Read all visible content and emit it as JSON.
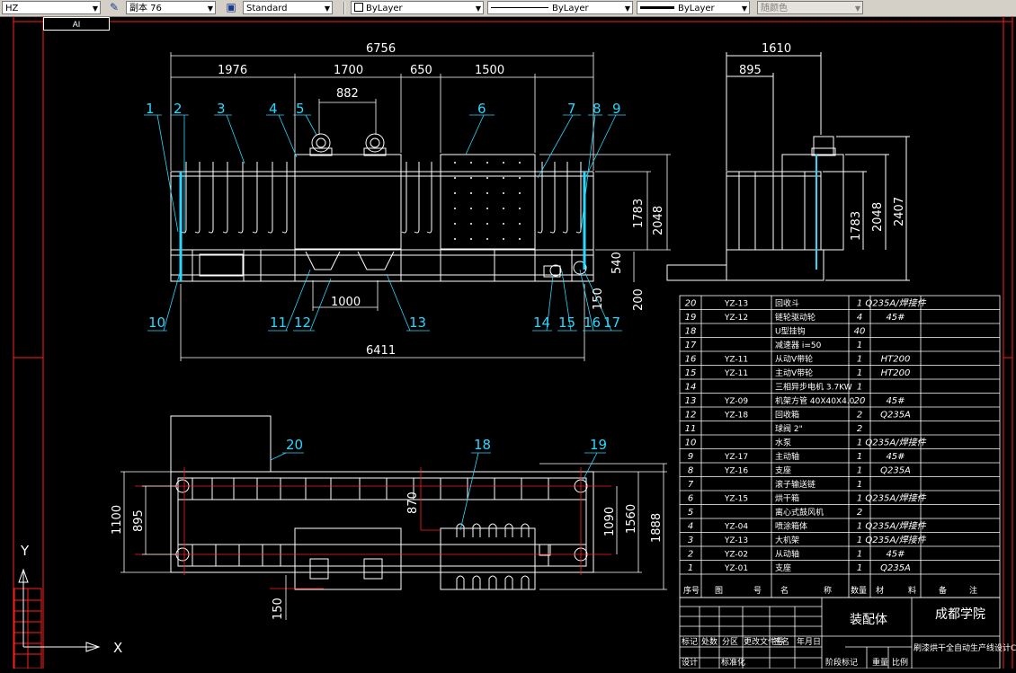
{
  "toolbar": {
    "layer": "HZ",
    "dimstyle": "副本 76",
    "textstyle": "Standard",
    "color": "ByLayer",
    "linetype": "ByLayer",
    "lineweight": "ByLayer",
    "plotstyle": "随颜色"
  },
  "tab": "AI",
  "ucs": {
    "x": "X",
    "y": "Y"
  },
  "colors": {
    "accent": "#29d8ff",
    "border": "#ff0000",
    "lines": "#ffffff"
  },
  "front_view": {
    "dims_top": [
      "6756",
      "1976",
      "1700",
      "650",
      "1500",
      "882"
    ],
    "dims_right": [
      "1783",
      "2048"
    ],
    "dims_small": [
      "540",
      "150",
      "200"
    ],
    "dims_bottom": [
      "1000",
      "6411"
    ],
    "callouts_top": [
      "1",
      "2",
      "3",
      "4",
      "5",
      "6",
      "7",
      "8",
      "9"
    ],
    "callouts_bottom": [
      "10",
      "11",
      "12",
      "13",
      "14",
      "15",
      "16",
      "17"
    ]
  },
  "side_view": {
    "dims": [
      "1610",
      "895",
      "1783",
      "2048",
      "2407"
    ]
  },
  "plan_view": {
    "dims_left": [
      "1100",
      "895"
    ],
    "dims_mid": [
      "870"
    ],
    "dims_right": [
      "1090",
      "1560",
      "1888"
    ],
    "dims_bottom": [
      "150"
    ],
    "callouts": [
      "20",
      "18",
      "19"
    ]
  },
  "parts_table": {
    "rows": [
      {
        "no": "20",
        "code": "YZ-13",
        "name": "回收斗",
        "qty": "1",
        "mat": "Q235A/焊接件"
      },
      {
        "no": "19",
        "code": "YZ-12",
        "name": "链轮驱动轮",
        "qty": "4",
        "mat": "45#"
      },
      {
        "no": "18",
        "code": "",
        "name": "U型挂钩",
        "qty": "40",
        "mat": ""
      },
      {
        "no": "17",
        "code": "",
        "name": "减速器 i=50",
        "qty": "1",
        "mat": ""
      },
      {
        "no": "16",
        "code": "YZ-11",
        "name": "从动V带轮",
        "qty": "1",
        "mat": "HT200"
      },
      {
        "no": "15",
        "code": "YZ-11",
        "name": "主动V带轮",
        "qty": "1",
        "mat": "HT200"
      },
      {
        "no": "14",
        "code": "",
        "name": "三相异步电机 3.7KW",
        "qty": "1",
        "mat": ""
      },
      {
        "no": "13",
        "code": "YZ-09",
        "name": "机架方管 40X40X4.0",
        "qty": "20",
        "mat": "45#"
      },
      {
        "no": "12",
        "code": "YZ-18",
        "name": "回收箱",
        "qty": "2",
        "mat": "Q235A"
      },
      {
        "no": "11",
        "code": "",
        "name": "球阀 2\"",
        "qty": "2",
        "mat": ""
      },
      {
        "no": "10",
        "code": "",
        "name": "水泵",
        "qty": "1",
        "mat": "Q235A/焊接件"
      },
      {
        "no": "9",
        "code": "YZ-17",
        "name": "主动轴",
        "qty": "1",
        "mat": "45#"
      },
      {
        "no": "8",
        "code": "YZ-16",
        "name": "支座",
        "qty": "1",
        "mat": "Q235A"
      },
      {
        "no": "7",
        "code": "",
        "name": "滚子输送链",
        "qty": "1",
        "mat": ""
      },
      {
        "no": "6",
        "code": "YZ-15",
        "name": "烘干箱",
        "qty": "1",
        "mat": "Q235A/焊接件"
      },
      {
        "no": "5",
        "code": "",
        "name": "离心式鼓风机",
        "qty": "2",
        "mat": ""
      },
      {
        "no": "4",
        "code": "YZ-04",
        "name": "喷涂箱体",
        "qty": "1",
        "mat": "Q235A/焊接件"
      },
      {
        "no": "3",
        "code": "YZ-13",
        "name": "大机架",
        "qty": "1",
        "mat": "Q235A/焊接件"
      },
      {
        "no": "2",
        "code": "YZ-02",
        "name": "从动轴",
        "qty": "1",
        "mat": "45#"
      },
      {
        "no": "1",
        "code": "YZ-01",
        "name": "支座",
        "qty": "1",
        "mat": "Q235A"
      }
    ],
    "header": [
      "序号",
      "图",
      "号",
      "名",
      "称",
      "数量",
      "材",
      "料",
      "备",
      "注"
    ]
  },
  "title_block": {
    "drawing_name": "装配体",
    "school": "成都学院",
    "project": "刷漆烘干全自动生产线设计CAD图",
    "labels": [
      "标记",
      "处数",
      "分区",
      "更改文件号",
      "签名",
      "年月日",
      "设计",
      "标准化",
      "阶段标记",
      "重量",
      "比例"
    ]
  }
}
